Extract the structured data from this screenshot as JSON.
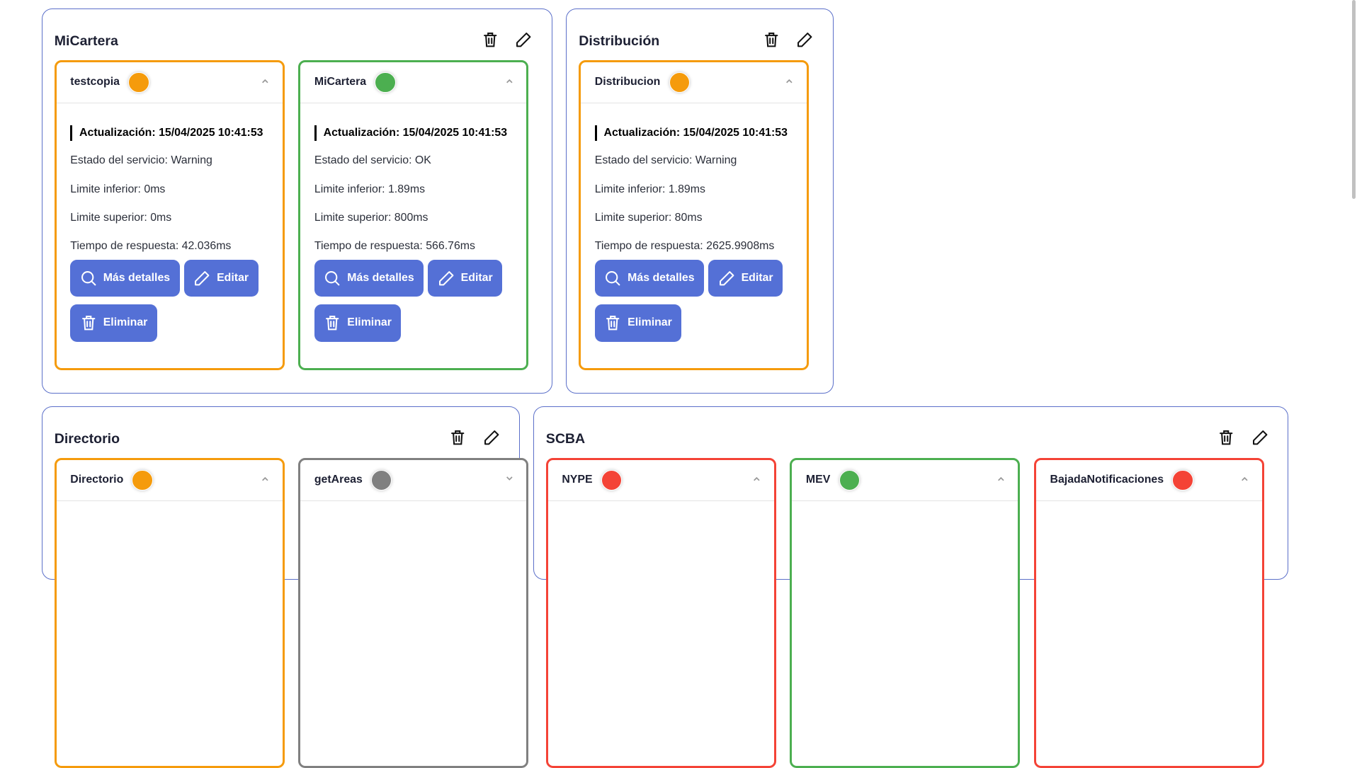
{
  "colors": {
    "group_border": "#5b6fc9",
    "button": "#5470d6",
    "warning": "#f59b0c",
    "ok": "#4caf50",
    "error": "#f44336",
    "unknown": "#808080"
  },
  "groups": [
    {
      "title": "MiCartera",
      "icons": [
        "trash-icon",
        "pencil-icon"
      ],
      "cards": [
        {
          "name": "testcopia",
          "status": "warning",
          "expanded": true,
          "updated": "Actualización: 15/04/2025 10:41:53",
          "lines": [
            "Estado del servicio: Warning",
            "Limite inferior: 0ms",
            "Limite superior: 0ms",
            "Tiempo de respuesta: 42.036ms"
          ],
          "buttons": [
            {
              "label": "Más detalles",
              "icon": "search-icon"
            },
            {
              "label": "Editar",
              "icon": "pencil-icon"
            },
            {
              "label": "Eliminar",
              "icon": "trash-icon"
            }
          ]
        },
        {
          "name": "MiCartera",
          "status": "ok",
          "expanded": true,
          "updated": "Actualización: 15/04/2025 10:41:53",
          "lines": [
            "Estado del servicio: OK",
            "Limite inferior: 1.89ms",
            "Limite superior: 800ms",
            "Tiempo de respuesta: 566.76ms"
          ],
          "buttons": [
            {
              "label": "Más detalles",
              "icon": "search-icon"
            },
            {
              "label": "Editar",
              "icon": "pencil-icon"
            },
            {
              "label": "Eliminar",
              "icon": "trash-icon"
            }
          ]
        }
      ]
    },
    {
      "title": "Distribución",
      "icons": [
        "trash-icon",
        "pencil-icon"
      ],
      "cards": [
        {
          "name": "Distribucion",
          "status": "warning",
          "expanded": true,
          "updated": "Actualización: 15/04/2025 10:41:53",
          "lines": [
            "Estado del servicio: Warning",
            "Limite inferior: 1.89ms",
            "Limite superior: 80ms",
            "Tiempo de respuesta: 2625.9908ms"
          ],
          "buttons": [
            {
              "label": "Más detalles",
              "icon": "search-icon"
            },
            {
              "label": "Editar",
              "icon": "pencil-icon"
            },
            {
              "label": "Eliminar",
              "icon": "trash-icon"
            }
          ]
        }
      ]
    },
    {
      "title": "Directorio",
      "icons": [
        "trash-icon",
        "pencil-icon"
      ],
      "cards": [
        {
          "name": "Directorio",
          "status": "warning",
          "expanded": true
        },
        {
          "name": "getAreas",
          "status": "unknown",
          "expanded": false
        }
      ]
    },
    {
      "title": "SCBA",
      "icons": [
        "trash-icon",
        "pencil-icon"
      ],
      "cards": [
        {
          "name": "NYPE",
          "status": "error",
          "expanded": true
        },
        {
          "name": "MEV",
          "status": "ok",
          "expanded": true
        },
        {
          "name": "BajadaNotificaciones",
          "status": "error",
          "expanded": true
        }
      ]
    }
  ]
}
